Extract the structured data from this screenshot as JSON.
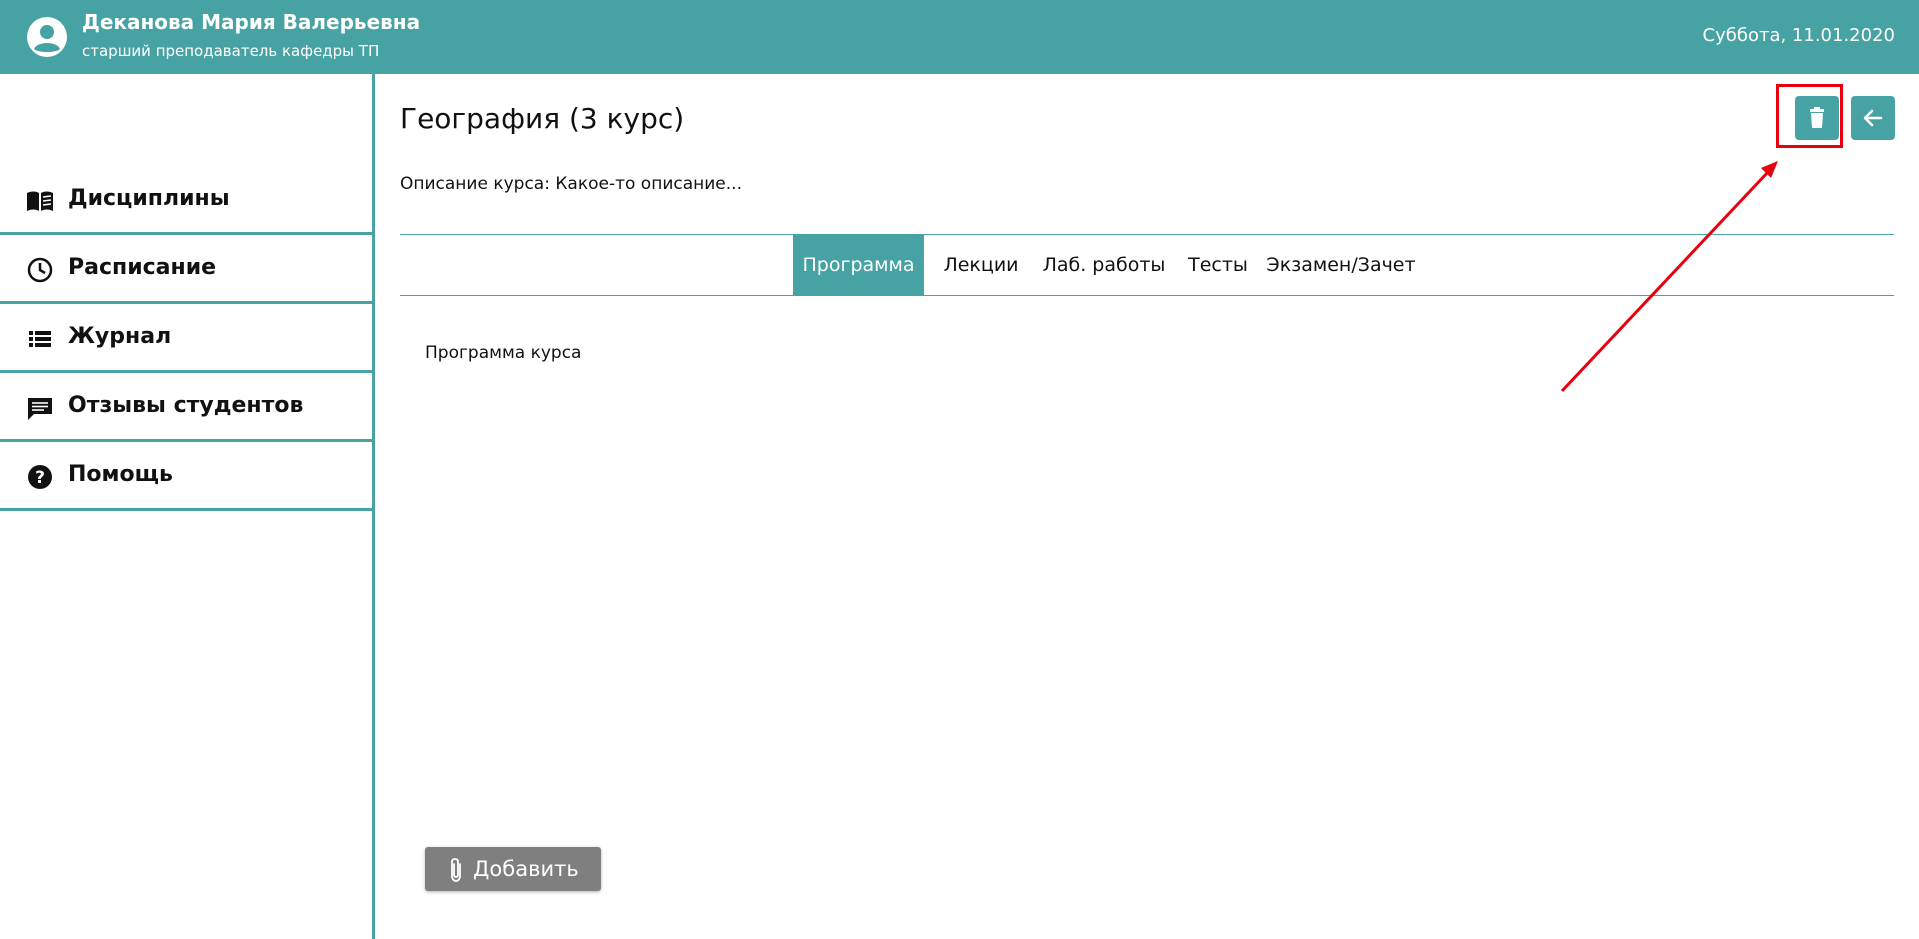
{
  "header": {
    "user_name": "Деканова Мария Валерьевна",
    "user_role": "старший преподаватель кафедры ТП",
    "date": "Суббота, 11.01.2020",
    "avatar_icon": "account-circle-icon"
  },
  "sidebar": {
    "items": [
      {
        "label": "Дисциплины",
        "icon": "book-open-icon"
      },
      {
        "label": "Расписание",
        "icon": "clock-icon"
      },
      {
        "label": "Журнал",
        "icon": "list-icon"
      },
      {
        "label": "Отзывы студентов",
        "icon": "comment-icon"
      },
      {
        "label": "Помощь",
        "icon": "help-circle-icon"
      }
    ]
  },
  "main": {
    "title": "География (3 курс)",
    "description": "Описание курса: Какое-то описание...",
    "tabs": [
      {
        "label": "Программа",
        "active": true
      },
      {
        "label": "Лекции",
        "active": false
      },
      {
        "label": "Лаб. работы",
        "active": false
      },
      {
        "label": "Тесты",
        "active": false
      },
      {
        "label": "Экзамен/Зачет",
        "active": false
      }
    ],
    "content_text": "Программа курса",
    "add_button_label": "Добавить",
    "delete_icon": "trash-icon",
    "back_icon": "arrow-left-icon"
  },
  "colors": {
    "accent": "#47a3a3",
    "annotation": "#e8000f",
    "add_button": "#7f7f7f"
  }
}
